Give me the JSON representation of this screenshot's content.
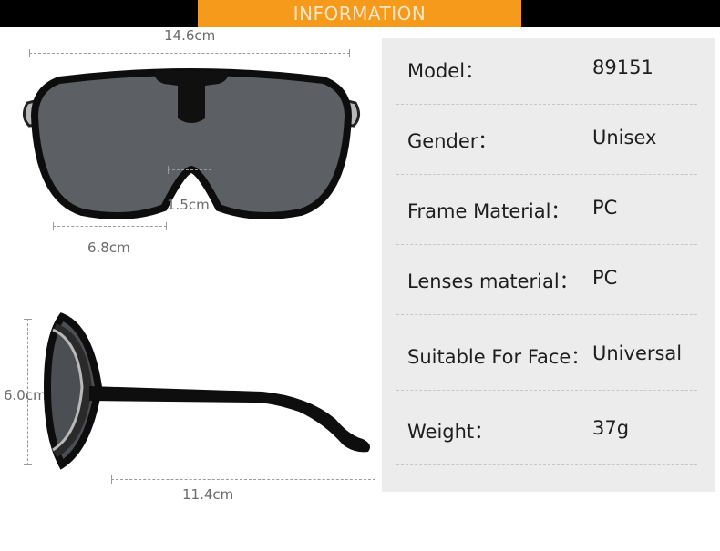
{
  "banner": {
    "title": "INFORMATION"
  },
  "dimensions": {
    "width_total": "14.6cm",
    "bridge": "1.5cm",
    "lens_width": "6.8cm",
    "lens_height": "6.0cm",
    "temple_length": "11.4cm"
  },
  "specs": [
    {
      "label": "Model：",
      "value": "89151"
    },
    {
      "label": "Gender：",
      "value": "Unisex"
    },
    {
      "label": "Frame Material：",
      "value": "PC"
    },
    {
      "label": "Lenses material：",
      "value": "PC"
    },
    {
      "label": "Suitable For Face：",
      "value": "Universal"
    },
    {
      "label": "Weight：",
      "value": "37g"
    }
  ],
  "colors": {
    "banner": "#f59a1a",
    "panel": "#ececec",
    "frame": "#111111",
    "lens": "#5c5f63"
  }
}
